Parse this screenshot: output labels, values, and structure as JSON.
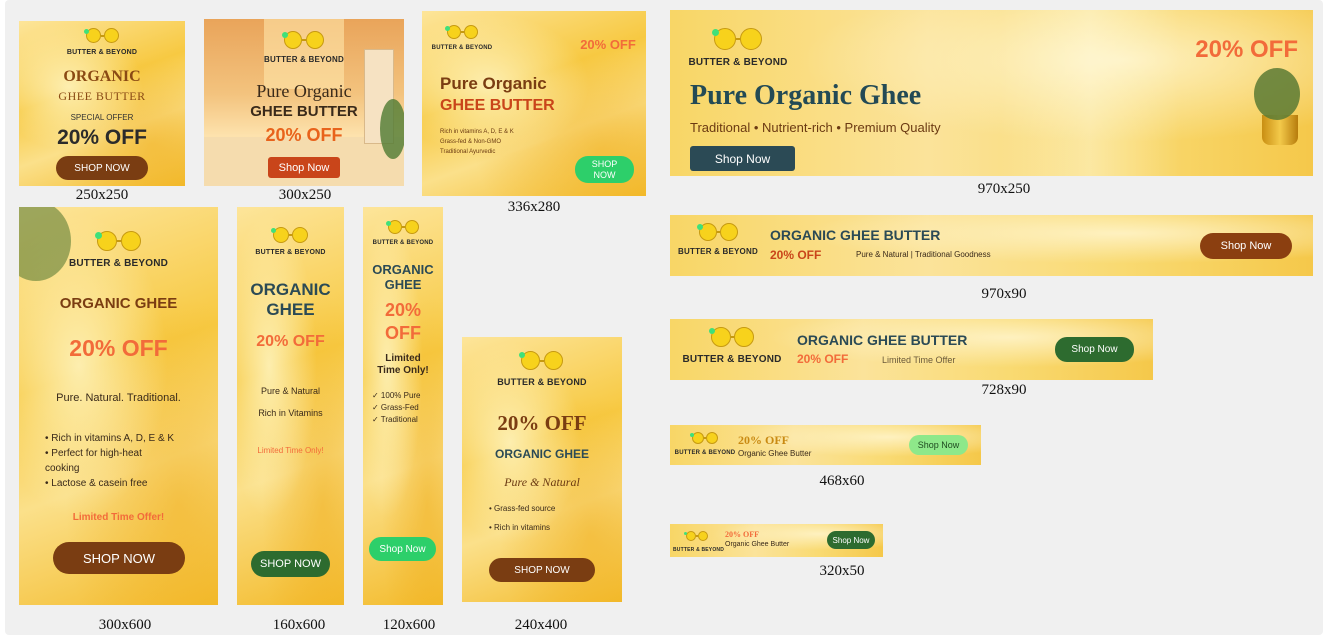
{
  "brand": "BUTTER & BEYOND",
  "colors": {
    "dark_brown": "#7a3d12",
    "orange": "#f26b3a",
    "green": "#2d6b2f",
    "teal": "#2b4a55",
    "light_green": "#2dcf6a"
  },
  "icons": {
    "logo": "sunglasses-logo-icon"
  },
  "banners": {
    "b250": {
      "size": "250x250",
      "line1": "ORGANIC",
      "line2": "GHEE BUTTER",
      "special": "SPECIAL OFFER",
      "offer": "20% OFF",
      "cta": "SHOP NOW"
    },
    "b300x250": {
      "size": "300x250",
      "line1": "Pure Organic",
      "line2": "GHEE BUTTER",
      "offer": "20% OFF",
      "cta": "Shop Now"
    },
    "b336": {
      "size": "336x280",
      "offer": "20% OFF",
      "line1": "Pure Organic",
      "line2": "GHEE BUTTER",
      "bullets": [
        "Rich in vitamins A, D, E & K",
        "Grass-fed & Non-GMO",
        "Traditional Ayurvedic"
      ],
      "cta1": "SHOP",
      "cta2": "NOW"
    },
    "b970x250": {
      "size": "970x250",
      "offer": "20% OFF",
      "title": "Pure Organic Ghee",
      "tagline": "Traditional • Nutrient-rich • Premium Quality",
      "cta": "Shop Now"
    },
    "b300x600": {
      "size": "300x600",
      "title": "ORGANIC GHEE",
      "offer": "20% OFF",
      "tagline": "Pure. Natural. Traditional.",
      "bullets": [
        "• Rich in vitamins A, D, E & K",
        "• Perfect for high-heat",
        "cooking",
        "• Lactose & casein free"
      ],
      "limited": "Limited Time Offer!",
      "cta": "SHOP NOW"
    },
    "b160": {
      "size": "160x600",
      "line1": "ORGANIC",
      "line2": "GHEE",
      "offer": "20% OFF",
      "f1": "Pure & Natural",
      "f2": "Rich in Vitamins",
      "limited": "Limited Time Only!",
      "cta": "SHOP NOW"
    },
    "b120": {
      "size": "120x600",
      "line1": "ORGANIC",
      "line2": "GHEE",
      "offer1": "20%",
      "offer2": "OFF",
      "lt1": "Limited",
      "lt2": "Time Only!",
      "checks": [
        "✓ 100% Pure",
        "✓ Grass-Fed",
        "✓ Traditional"
      ],
      "cta": "Shop Now"
    },
    "b240": {
      "size": "240x400",
      "offer": "20% OFF",
      "title": "ORGANIC GHEE",
      "tagline": "Pure & Natural",
      "bullets": [
        "• Grass-fed source",
        "• Rich in vitamins"
      ],
      "cta": "SHOP NOW"
    },
    "b970x90": {
      "size": "970x90",
      "title": "ORGANIC GHEE BUTTER",
      "offer": "20% OFF",
      "tagline": "Pure & Natural | Traditional Goodness",
      "cta": "Shop Now"
    },
    "b728": {
      "size": "728x90",
      "title": "ORGANIC GHEE BUTTER",
      "offer": "20% OFF",
      "tagline": "Limited Time Offer",
      "cta": "Shop Now"
    },
    "b468": {
      "size": "468x60",
      "offer": "20% OFF",
      "sub": "Organic Ghee Butter",
      "cta": "Shop Now"
    },
    "b320": {
      "size": "320x50",
      "offer": "20% OFF",
      "sub": "Organic Ghee Butter",
      "cta": "Shop Now"
    }
  }
}
